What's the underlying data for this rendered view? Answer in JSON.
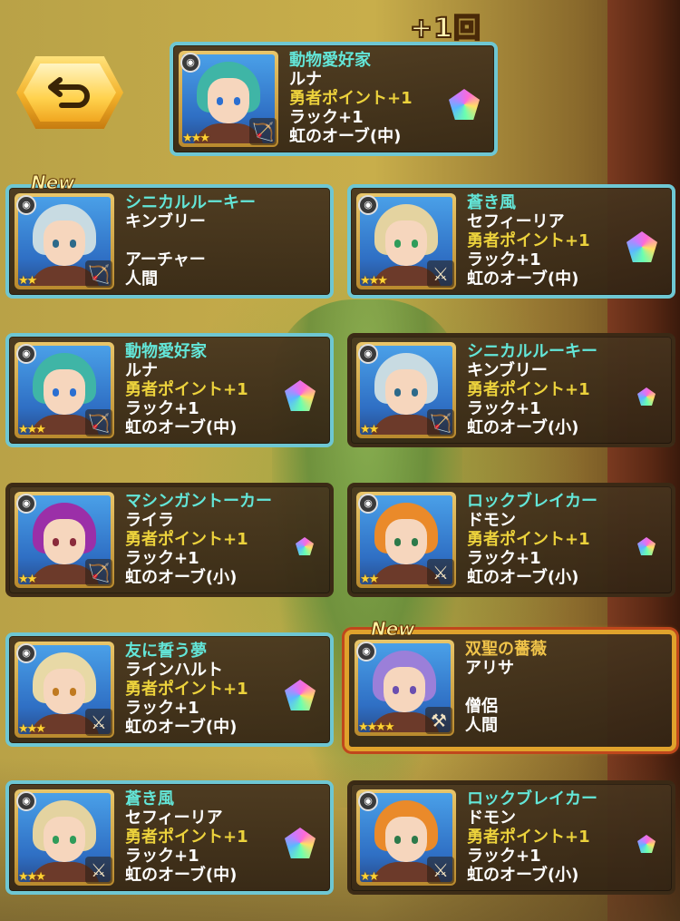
{
  "bonus": "+1回",
  "new_label": "New",
  "cards": [
    {
      "title": "動物愛好家",
      "name": "ルナ",
      "line3": "勇者ポイント+1",
      "line4": "ラック+1",
      "line5": "虹のオーブ(中)",
      "stars": "★★★",
      "gem": "large",
      "hair": "#3fb5a6",
      "eyes": "#2b6fd1",
      "weapon": "bow",
      "state": "highlighted"
    },
    {
      "title": "シニカルルーキー",
      "name": "キンブリー",
      "line3": "",
      "line4": "アーチャー",
      "line5": "人間",
      "stars": "★★",
      "gem": "none",
      "hair": "#c8dbe2",
      "eyes": "#2d6a8a",
      "weapon": "bow",
      "state": "new"
    },
    {
      "title": "蒼き風",
      "name": "セフィーリア",
      "line3": "勇者ポイント+1",
      "line4": "ラック+1",
      "line5": "虹のオーブ(中)",
      "stars": "★★★",
      "gem": "large",
      "hair": "#e4d3a0",
      "eyes": "#2f9c5a",
      "weapon": "sword",
      "state": "highlighted"
    },
    {
      "title": "動物愛好家",
      "name": "ルナ",
      "line3": "勇者ポイント+1",
      "line4": "ラック+1",
      "line5": "虹のオーブ(中)",
      "stars": "★★★",
      "gem": "large",
      "hair": "#3fb5a6",
      "eyes": "#2b6fd1",
      "weapon": "bow",
      "state": "highlighted"
    },
    {
      "title": "シニカルルーキー",
      "name": "キンブリー",
      "line3": "勇者ポイント+1",
      "line4": "ラック+1",
      "line5": "虹のオーブ(小)",
      "stars": "★★",
      "gem": "small",
      "hair": "#c8dbe2",
      "eyes": "#2d6a8a",
      "weapon": "bow",
      "state": "dark"
    },
    {
      "title": "マシンガントーカー",
      "name": "ライラ",
      "line3": "勇者ポイント+1",
      "line4": "ラック+1",
      "line5": "虹のオーブ(小)",
      "stars": "★★",
      "gem": "small",
      "hair": "#9b2fa8",
      "eyes": "#8a2b3b",
      "weapon": "bow",
      "state": "dark"
    },
    {
      "title": "ロックブレイカー",
      "name": "ドモン",
      "line3": "勇者ポイント+1",
      "line4": "ラック+1",
      "line5": "虹のオーブ(小)",
      "stars": "★★",
      "gem": "small",
      "hair": "#ea8a2a",
      "eyes": "#2d7a4a",
      "weapon": "sword",
      "state": "dark"
    },
    {
      "title": "友に誓う夢",
      "name": "ラインハルト",
      "line3": "勇者ポイント+1",
      "line4": "ラック+1",
      "line5": "虹のオーブ(中)",
      "stars": "★★★",
      "gem": "large",
      "hair": "#e8d9a6",
      "eyes": "#c07a20",
      "weapon": "sword",
      "state": "highlighted"
    },
    {
      "title": "双聖の薔薇",
      "name": "アリサ",
      "line3": "",
      "line4": "僧侶",
      "line5": "人間",
      "stars": "★★★★",
      "gem": "none",
      "hair": "#9b7fd9",
      "eyes": "#6a4fb0",
      "weapon": "axe",
      "state": "gold-new"
    },
    {
      "title": "蒼き風",
      "name": "セフィーリア",
      "line3": "勇者ポイント+1",
      "line4": "ラック+1",
      "line5": "虹のオーブ(中)",
      "stars": "★★★",
      "gem": "large",
      "hair": "#e4d3a0",
      "eyes": "#2f9c5a",
      "weapon": "sword",
      "state": "highlighted"
    },
    {
      "title": "ロックブレイカー",
      "name": "ドモン",
      "line3": "勇者ポイント+1",
      "line4": "ラック+1",
      "line5": "虹のオーブ(小)",
      "stars": "★★",
      "gem": "small",
      "hair": "#ea8a2a",
      "eyes": "#2d7a4a",
      "weapon": "sword",
      "state": "dark"
    }
  ],
  "icons": {
    "back": "return-arrow-icon",
    "class": "class-badge-icon",
    "bow": "bow-icon",
    "sword": "sword-icon",
    "axe": "axe-icon",
    "orb": "rainbow-orb-icon",
    "star": "star-icon"
  }
}
